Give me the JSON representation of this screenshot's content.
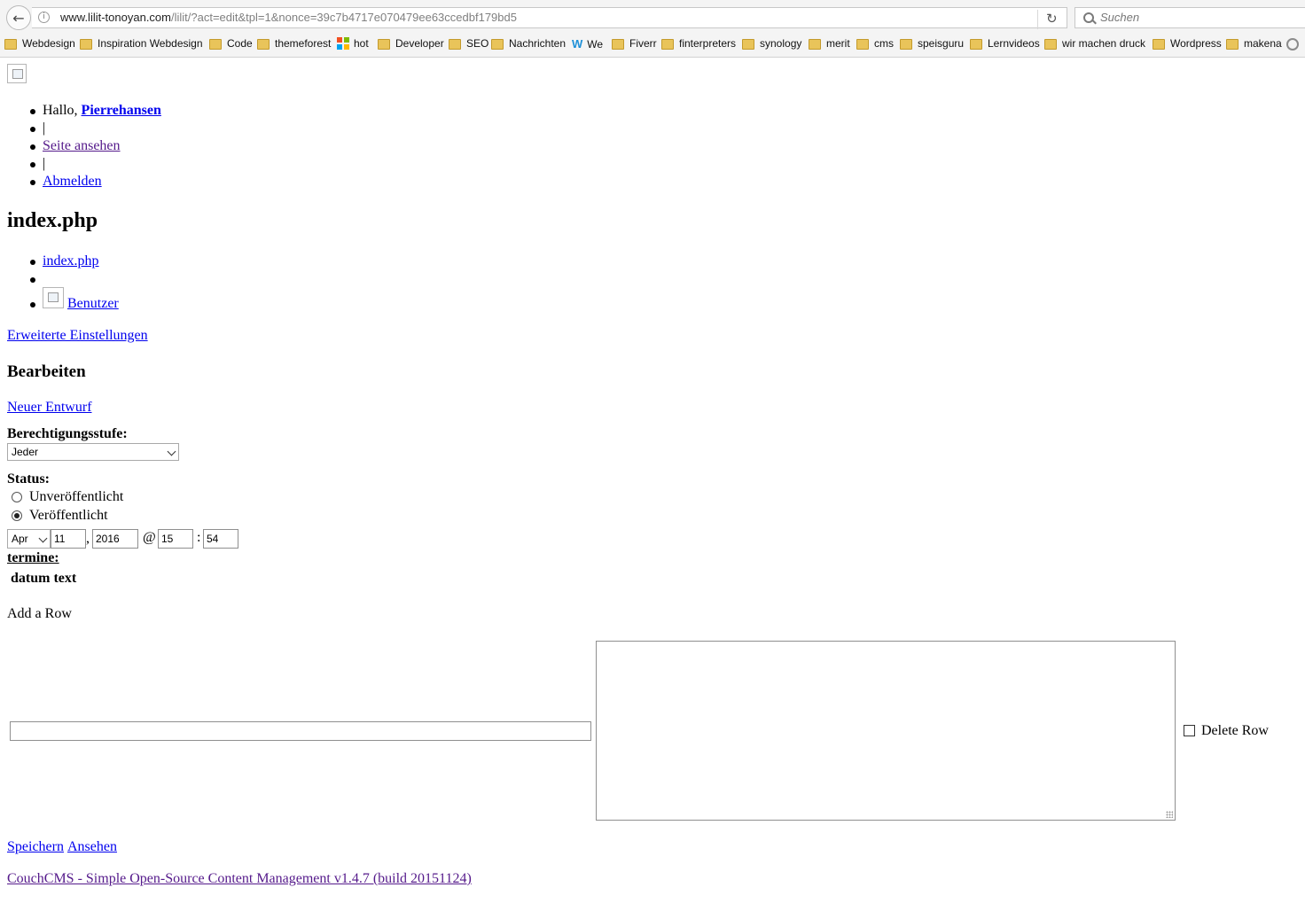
{
  "browser": {
    "url_host": "www.lilit-tonoyan.com",
    "url_path": "/lilit/?act=edit&tpl=1&nonce=39c7b4717e070479ee63ccedbf179bd5",
    "search_placeholder": "Suchen",
    "bookmarks": [
      "Webdesign",
      "Inspiration Webdesign",
      "Code",
      "themeforest",
      "hot",
      "Developer",
      "SEO",
      "Nachrichten",
      "We",
      "Fiverr",
      "finterpreters",
      "synology",
      "merit",
      "cms",
      "speisguru",
      "Lernvideos",
      "wir machen druck",
      "Wordpress",
      "makena"
    ]
  },
  "user_nav": {
    "greeting": "Hallo,",
    "username": "Pierrehansen",
    "sep1": "|",
    "view_site": "Seite ansehen",
    "sep2": "|",
    "logout": "Abmelden"
  },
  "page_title": "index.php",
  "sub_nav": {
    "item1": "index.php",
    "item2": "",
    "item3": "Benutzer"
  },
  "advanced_settings": "Erweiterte Einstellungen",
  "section_title": "Bearbeiten",
  "new_draft": "Neuer Entwurf",
  "access_level": {
    "label": "Berechtigungsstufe:",
    "value": "Jeder"
  },
  "status": {
    "label": "Status:",
    "options": [
      "Unveröffentlicht",
      "Veröffentlicht"
    ],
    "selected": "Veröffentlicht"
  },
  "date": {
    "month": "Apr",
    "day": "11",
    "comma": ",",
    "year": "2016",
    "at": "@",
    "hour": "15",
    "colon": ":",
    "minute": "54"
  },
  "termine": {
    "label": "termine:",
    "col1": "datum",
    "col2": "text",
    "add_row": "Add a Row",
    "row_input_value": "",
    "row_textarea_value": "",
    "delete_row": "Delete Row"
  },
  "actions": {
    "save": "Speichern",
    "view": "Ansehen"
  },
  "footer": "CouchCMS - Simple Open-Source Content Management v1.4.7 (build 20151124)"
}
